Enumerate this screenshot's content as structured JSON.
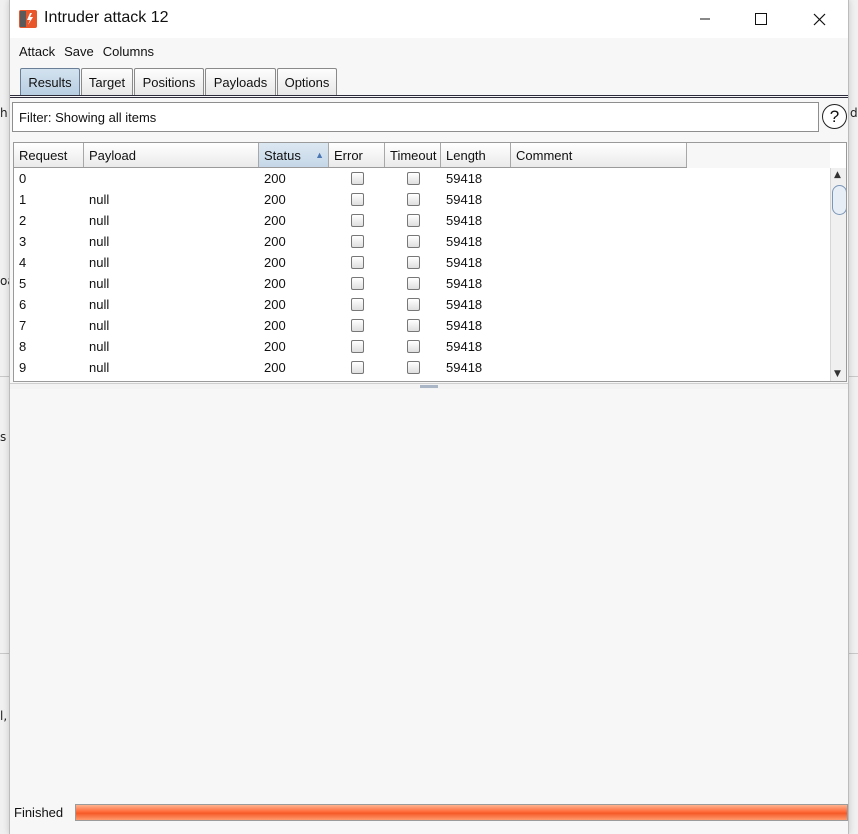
{
  "window": {
    "title": "Intruder attack 12",
    "controls": {
      "minimize": "minimize",
      "maximize": "maximize",
      "close": "close"
    }
  },
  "menu": {
    "items": [
      "Attack",
      "Save",
      "Columns"
    ]
  },
  "tabs": [
    {
      "label": "Results",
      "active": true
    },
    {
      "label": "Target",
      "active": false
    },
    {
      "label": "Positions",
      "active": false
    },
    {
      "label": "Payloads",
      "active": false
    },
    {
      "label": "Options",
      "active": false
    }
  ],
  "filter": {
    "text": "Filter: Showing all items"
  },
  "help": {
    "label": "?"
  },
  "table": {
    "columns": [
      "Request",
      "Payload",
      "Status",
      "Error",
      "Timeout",
      "Length",
      "Comment"
    ],
    "sorted_column": "Status",
    "sort_direction": "ascending",
    "rows": [
      {
        "request": "0",
        "payload": "",
        "status": "200",
        "error": false,
        "timeout": false,
        "length": "59418",
        "comment": ""
      },
      {
        "request": "1",
        "payload": "null",
        "status": "200",
        "error": false,
        "timeout": false,
        "length": "59418",
        "comment": ""
      },
      {
        "request": "2",
        "payload": "null",
        "status": "200",
        "error": false,
        "timeout": false,
        "length": "59418",
        "comment": ""
      },
      {
        "request": "3",
        "payload": "null",
        "status": "200",
        "error": false,
        "timeout": false,
        "length": "59418",
        "comment": ""
      },
      {
        "request": "4",
        "payload": "null",
        "status": "200",
        "error": false,
        "timeout": false,
        "length": "59418",
        "comment": ""
      },
      {
        "request": "5",
        "payload": "null",
        "status": "200",
        "error": false,
        "timeout": false,
        "length": "59418",
        "comment": ""
      },
      {
        "request": "6",
        "payload": "null",
        "status": "200",
        "error": false,
        "timeout": false,
        "length": "59418",
        "comment": ""
      },
      {
        "request": "7",
        "payload": "null",
        "status": "200",
        "error": false,
        "timeout": false,
        "length": "59418",
        "comment": ""
      },
      {
        "request": "8",
        "payload": "null",
        "status": "200",
        "error": false,
        "timeout": false,
        "length": "59418",
        "comment": ""
      },
      {
        "request": "9",
        "payload": "null",
        "status": "200",
        "error": false,
        "timeout": false,
        "length": "59418",
        "comment": ""
      }
    ]
  },
  "status": {
    "text": "Finished",
    "progress": 1.0
  },
  "background_fragments": {
    "a": "h",
    "b": "di",
    "c": "oa",
    "d": "s",
    "e": "l,"
  },
  "colors": {
    "progress": "#f55a27",
    "active_tab": "#b9cfe2",
    "icon_orange": "#e8562a"
  }
}
